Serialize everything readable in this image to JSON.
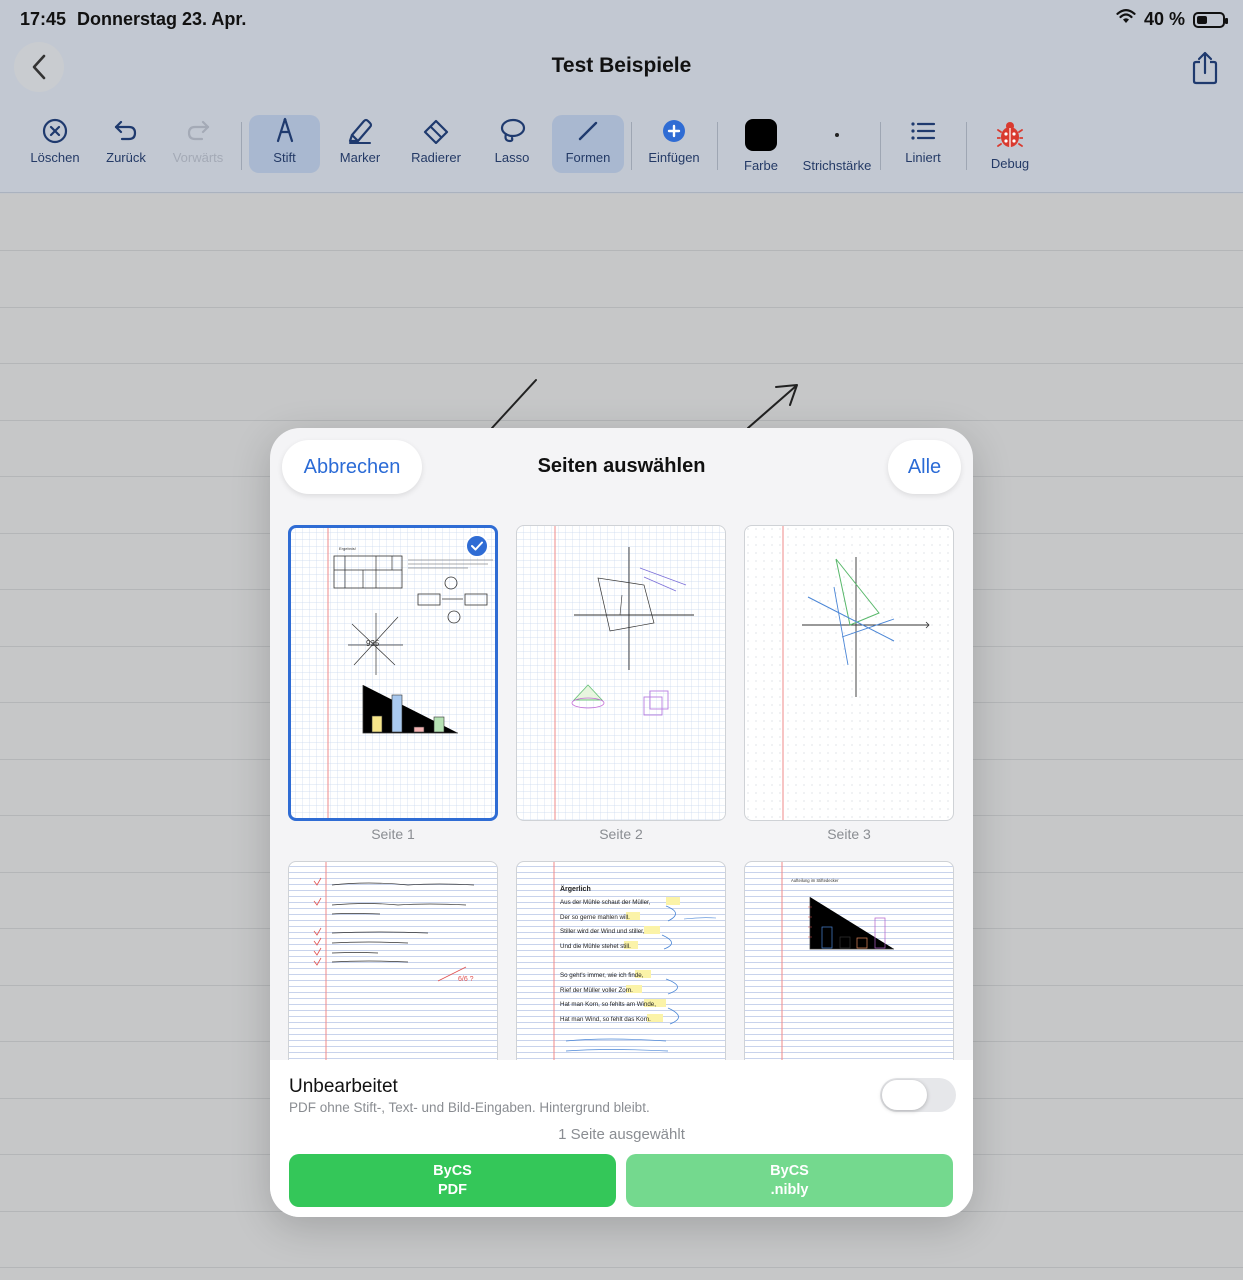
{
  "status_bar": {
    "time": "17:45",
    "date": "Donnerstag 23. Apr.",
    "battery": "40 %",
    "battery_level": 0.4
  },
  "nav": {
    "title": "Test Beispiele"
  },
  "toolbar": {
    "tools": [
      {
        "key": "delete",
        "label": "Löschen",
        "icon": "x-circle-icon"
      },
      {
        "key": "undo",
        "label": "Zurück",
        "icon": "undo-icon"
      },
      {
        "key": "redo",
        "label": "Vorwärts",
        "icon": "redo-icon",
        "disabled": true
      },
      {
        "key": "pen",
        "label": "Stift",
        "icon": "pen-nib-icon",
        "active": true
      },
      {
        "key": "marker",
        "label": "Marker",
        "icon": "marker-icon"
      },
      {
        "key": "eraser",
        "label": "Radierer",
        "icon": "eraser-icon"
      },
      {
        "key": "lasso",
        "label": "Lasso",
        "icon": "lasso-icon"
      },
      {
        "key": "shapes",
        "label": "Formen",
        "icon": "line-icon",
        "active": true
      },
      {
        "key": "insert",
        "label": "Einfügen",
        "icon": "plus-circle-icon"
      },
      {
        "key": "color",
        "label": "Farbe",
        "icon": "color-swatch",
        "color": "#000000"
      },
      {
        "key": "stroke",
        "label": "Strichstärke",
        "icon": "dot-icon"
      },
      {
        "key": "ruled",
        "label": "Liniert",
        "icon": "list-icon"
      },
      {
        "key": "debug",
        "label": "Debug",
        "icon": "ladybug-icon",
        "color": "#d93a2f"
      }
    ]
  },
  "modal": {
    "cancel": "Abbrechen",
    "title": "Seiten auswählen",
    "all": "Alle",
    "pages": [
      {
        "label": "Seite 1",
        "selected": true
      },
      {
        "label": "Seite 2",
        "selected": false
      },
      {
        "label": "Seite 3",
        "selected": false
      },
      {
        "label": "",
        "selected": false
      },
      {
        "label": "",
        "selected": false
      },
      {
        "label": "",
        "selected": false
      }
    ],
    "page5_text": {
      "heading": "Ärgerlich",
      "lines": [
        "Aus der Mühle schaut der Müller,",
        "Der so gerne mahlen will.",
        "Stiller wird der Wind und stiller,",
        "Und die Mühle stehet still.",
        "So geht's immer, wie ich finde,",
        "Rief der Müller voller Zorn.",
        "Hat man Korn, so fehlts am Winde,",
        "Hat man Wind, so fehlt das Korn."
      ]
    },
    "page6_text": {
      "heading": "Aufteilung im Stiftedecker"
    },
    "unedited_title": "Unbearbeitet",
    "unedited_desc": "PDF ohne Stift-, Text- und Bild-Eingaben. Hintergrund bleibt.",
    "toggle_on": false,
    "selection_count": "1 Seite ausgewählt",
    "btn_pdf": {
      "line1": "ByCS",
      "line2": "PDF",
      "color": "#34c759"
    },
    "btn_nibly": {
      "line1": "ByCS",
      "line2": ".nibly",
      "color": "#74d98e"
    }
  }
}
